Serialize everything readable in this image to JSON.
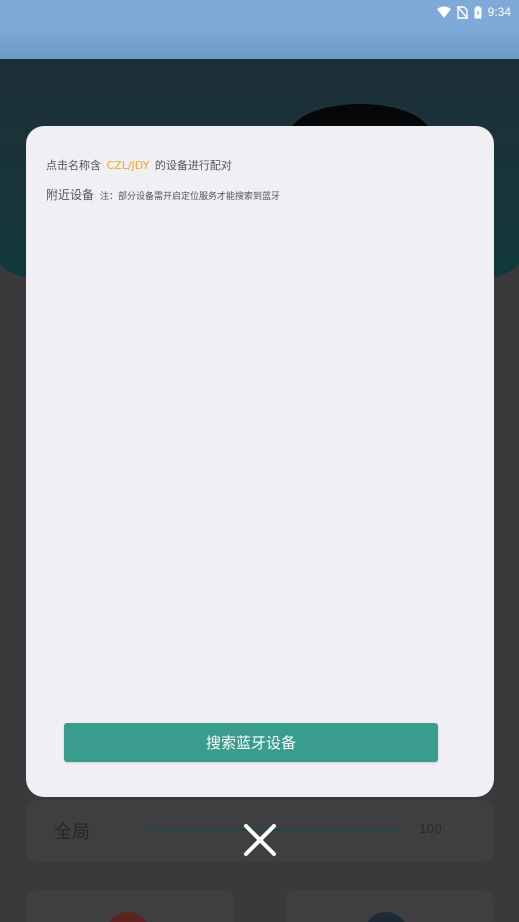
{
  "status_bar": {
    "time": "9:34",
    "icons": [
      "wifi-icon",
      "no-sim-icon",
      "battery-icon"
    ]
  },
  "modal": {
    "hint_prefix": "点击名称含",
    "hint_accent": "CZL/JDY",
    "hint_suffix": "的设备进行配对",
    "nearby_title": "附近设备",
    "nearby_note": "注：部分设备需开启定位服务才能搜索到蓝牙",
    "devices": [],
    "search_button": "搜索蓝牙设备"
  },
  "background": {
    "global_label": "全局",
    "global_value": "100"
  },
  "colors": {
    "accent": "#f5a623",
    "button": "#3a9c8d",
    "modal_bg": "#efeff4",
    "overlay": "#3a3a3c"
  },
  "icons": {
    "close": "close-icon"
  }
}
